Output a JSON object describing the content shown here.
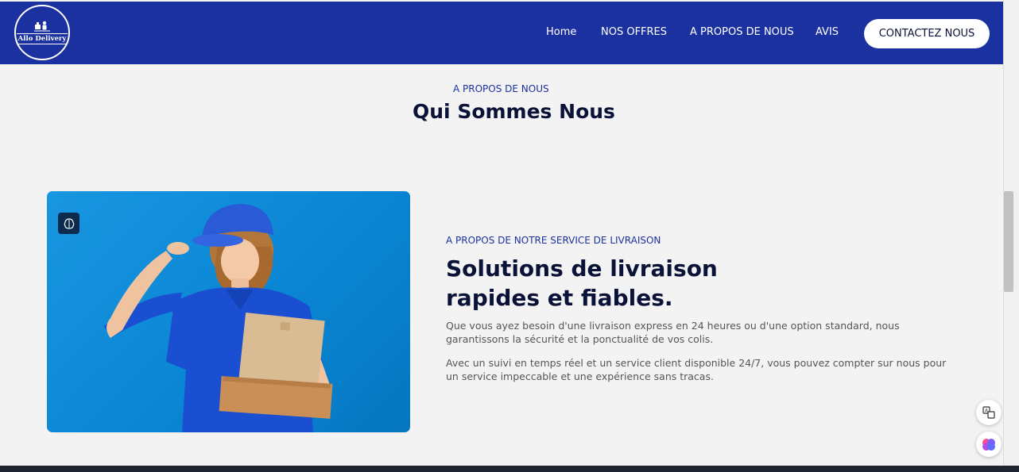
{
  "brand": {
    "name": "Allo Delivery",
    "nav_color": "#1c31a0"
  },
  "nav": {
    "home": "Home",
    "offers": "NOS OFFRES",
    "about": "A PROPOS DE NOUS",
    "reviews": "AVIS",
    "contact": "CONTACTEZ NOUS"
  },
  "section": {
    "eyebrow": "A PROPOS DE NOUS",
    "title": "Qui Sommes Nous"
  },
  "about": {
    "eyebrow": "A PROPOS DE NOTRE SERVICE DE LIVRAISON",
    "title_line1": "Solutions de livraison",
    "title_line2": "rapides et fiables.",
    "para1": "Que vous ayez besoin d'une livraison express en 24 heures ou d'une option standard, nous garantissons la sécurité et la ponctualité de vos colis.",
    "para2": "Avec un suivi en temps réel et un service client disponible 24/7, vous pouvez compter sur nous pour un service impeccable et une expérience sans tracas."
  },
  "icons": {
    "hero_badge": "brain-icon",
    "translate": "translate-icon",
    "assistant": "brain-assistant-icon"
  }
}
